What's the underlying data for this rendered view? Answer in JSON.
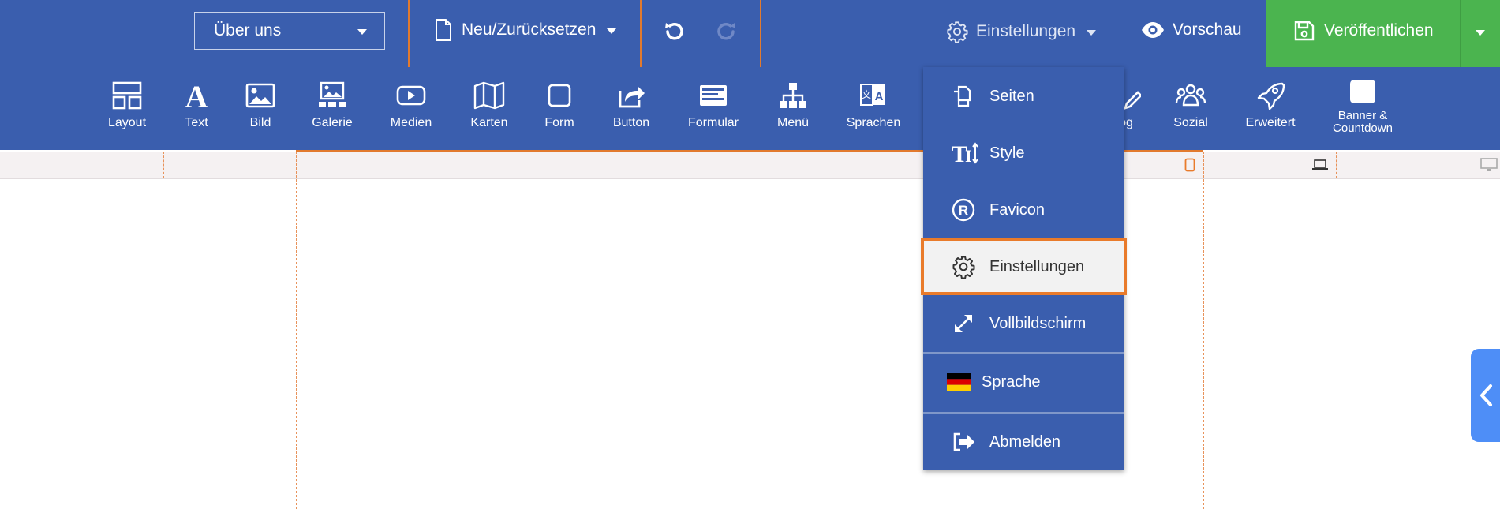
{
  "topbar": {
    "page_select": "Über uns",
    "new_reset": "Neu/Zurücksetzen",
    "settings": "Einstellungen",
    "preview": "Vorschau",
    "publish": "Veröffentlichen"
  },
  "toolbar": {
    "items": [
      {
        "label": "Layout",
        "icon": "layout-icon"
      },
      {
        "label": "Text",
        "icon": "text-icon"
      },
      {
        "label": "Bild",
        "icon": "image-icon"
      },
      {
        "label": "Galerie",
        "icon": "gallery-icon"
      },
      {
        "label": "Medien",
        "icon": "media-icon"
      },
      {
        "label": "Karten",
        "icon": "map-icon"
      },
      {
        "label": "Form",
        "icon": "shape-icon"
      },
      {
        "label": "Button",
        "icon": "button-icon"
      },
      {
        "label": "Formular",
        "icon": "form-icon"
      },
      {
        "label": "Menü",
        "icon": "menu-tree-icon"
      },
      {
        "label": "Sprachen",
        "icon": "languages-icon"
      },
      {
        "label": "og",
        "icon": "blog-icon"
      },
      {
        "label": "Sozial",
        "icon": "social-icon"
      },
      {
        "label": "Erweitert",
        "icon": "rocket-icon"
      },
      {
        "label": "Banner & Countdown",
        "label_line1": "Banner &",
        "label_line2": "Countdown",
        "icon": "banner-icon"
      }
    ]
  },
  "menu": {
    "items": [
      {
        "label": "Seiten",
        "icon": "pages-icon"
      },
      {
        "label": "Style",
        "icon": "style-icon"
      },
      {
        "label": "Favicon",
        "icon": "favicon-icon"
      },
      {
        "label": "Einstellungen",
        "icon": "gear-icon",
        "active": true
      },
      {
        "label": "Vollbildschirm",
        "icon": "fullscreen-icon"
      },
      {
        "label": "Sprache",
        "icon": "german-flag-icon"
      },
      {
        "label": "Abmelden",
        "icon": "logout-icon"
      }
    ]
  },
  "colors": {
    "primary": "#3a5eae",
    "publish": "#4bb44f",
    "highlight": "#e97b2b",
    "side_tab": "#4e8ef7"
  }
}
